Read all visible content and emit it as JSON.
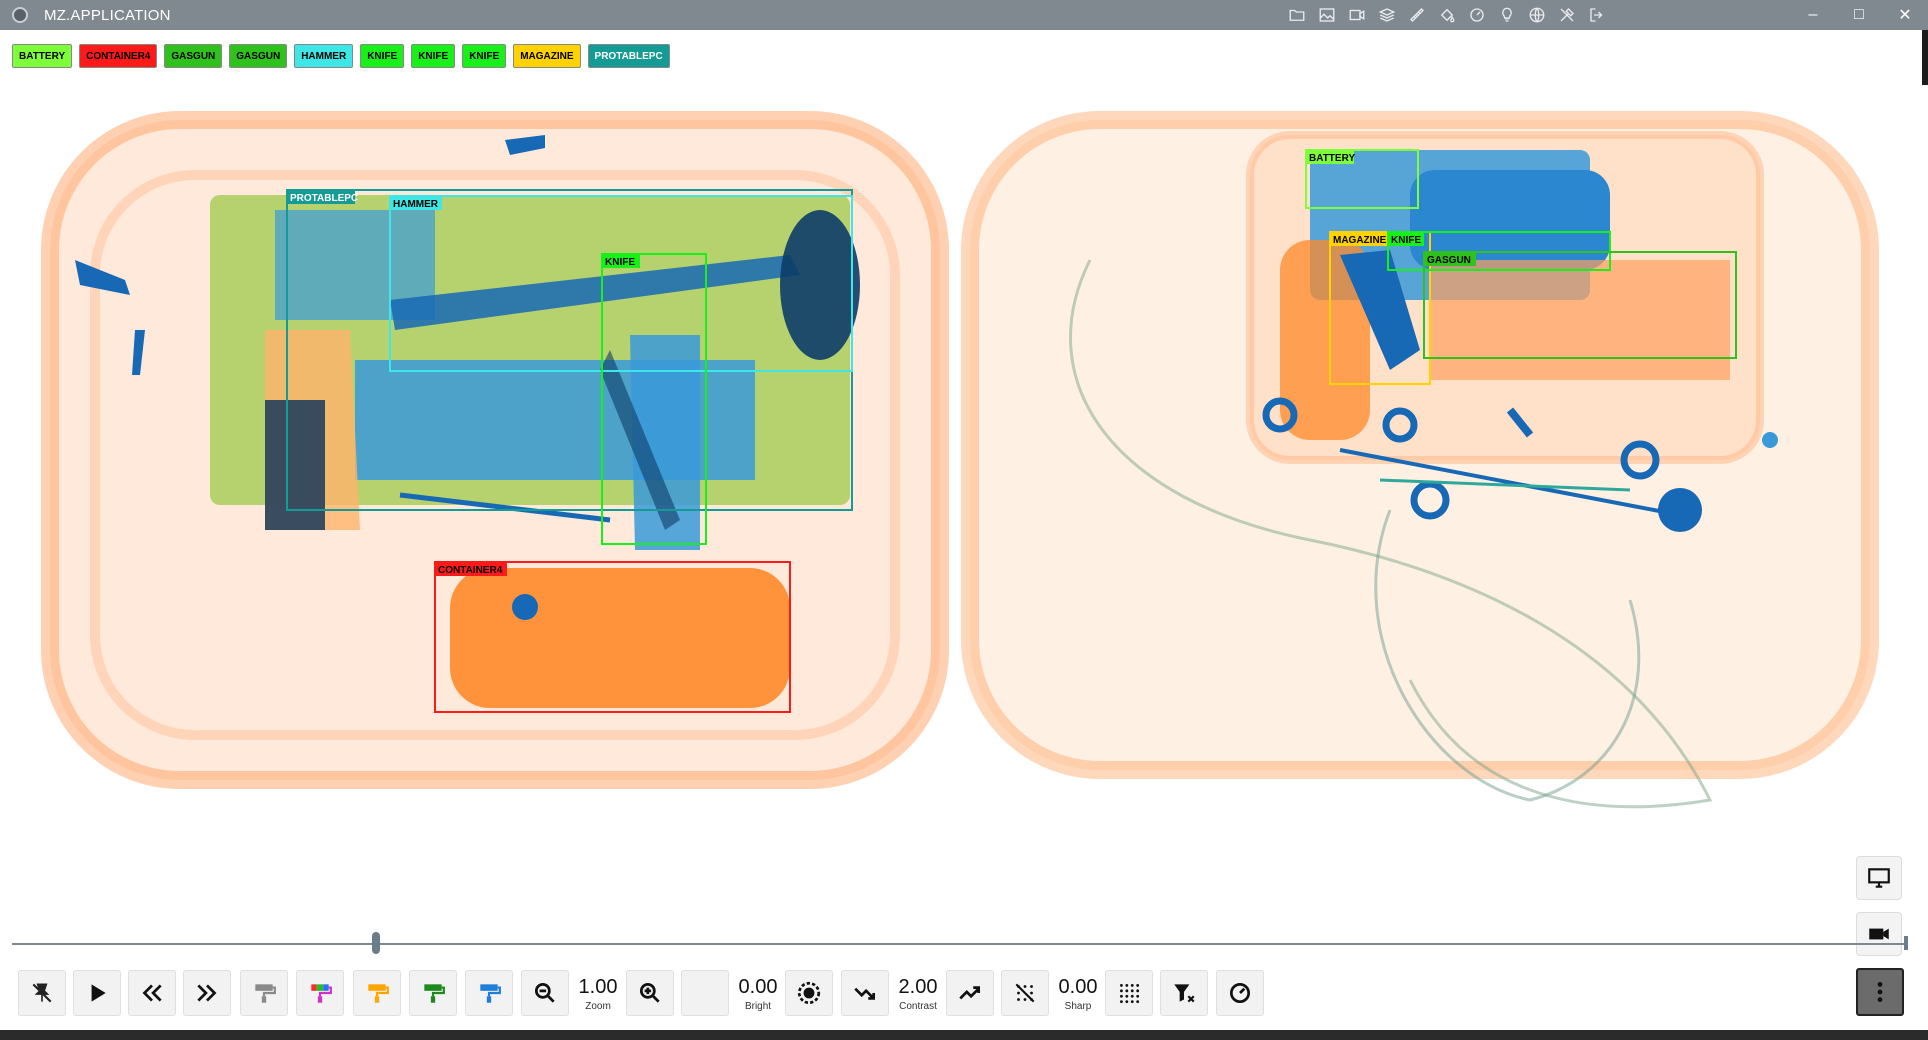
{
  "window": {
    "title": "MZ.APPLICATION",
    "icons": [
      "folder-icon",
      "image-icon",
      "video-icon",
      "layers-icon",
      "ruler-icon",
      "paint-bucket-icon",
      "dashboard-icon",
      "lightbulb-icon",
      "globe-icon",
      "tools-icon",
      "logout-icon"
    ],
    "controls": [
      "–",
      "□",
      "✕"
    ]
  },
  "legend": [
    {
      "label": "BATTERY",
      "color": "#7dff3a"
    },
    {
      "label": "CONTAINER4",
      "color": "#ff1a1a"
    },
    {
      "label": "GASGUN",
      "color": "#2fc21c"
    },
    {
      "label": "GASGUN",
      "color": "#2fc21c"
    },
    {
      "label": "HAMMER",
      "color": "#3ee6e6"
    },
    {
      "label": "KNIFE",
      "color": "#19f019"
    },
    {
      "label": "KNIFE",
      "color": "#19f019"
    },
    {
      "label": "KNIFE",
      "color": "#19f019"
    },
    {
      "label": "MAGAZINE",
      "color": "#ffd200"
    },
    {
      "label": "PROTABLEPC",
      "color": "#149b95"
    }
  ],
  "detections": {
    "left": {
      "protablepc": "PROTABLEPC",
      "hammer": "HAMMER",
      "knife": "KNIFE",
      "container": "CONTAINER4"
    },
    "right": {
      "battery": "BATTERY",
      "magazine": "MAGAZINE",
      "knife": "KNIFE",
      "gasgun": "GASGUN"
    }
  },
  "toolbar": {
    "zoom": {
      "value": "1.00",
      "caption": "Zoom"
    },
    "bright": {
      "value": "0.00",
      "caption": "Bright"
    },
    "contrast": {
      "value": "2.00",
      "caption": "Contrast"
    },
    "sharp": {
      "value": "0.00",
      "caption": "Sharp"
    },
    "colors": {
      "brush_gray": "#8a8a8a",
      "brush_orange": "#ffa500",
      "brush_green": "#1e8a1e",
      "brush_blue": "#1e7fd8"
    }
  },
  "timeline": {
    "position": 0.19
  }
}
